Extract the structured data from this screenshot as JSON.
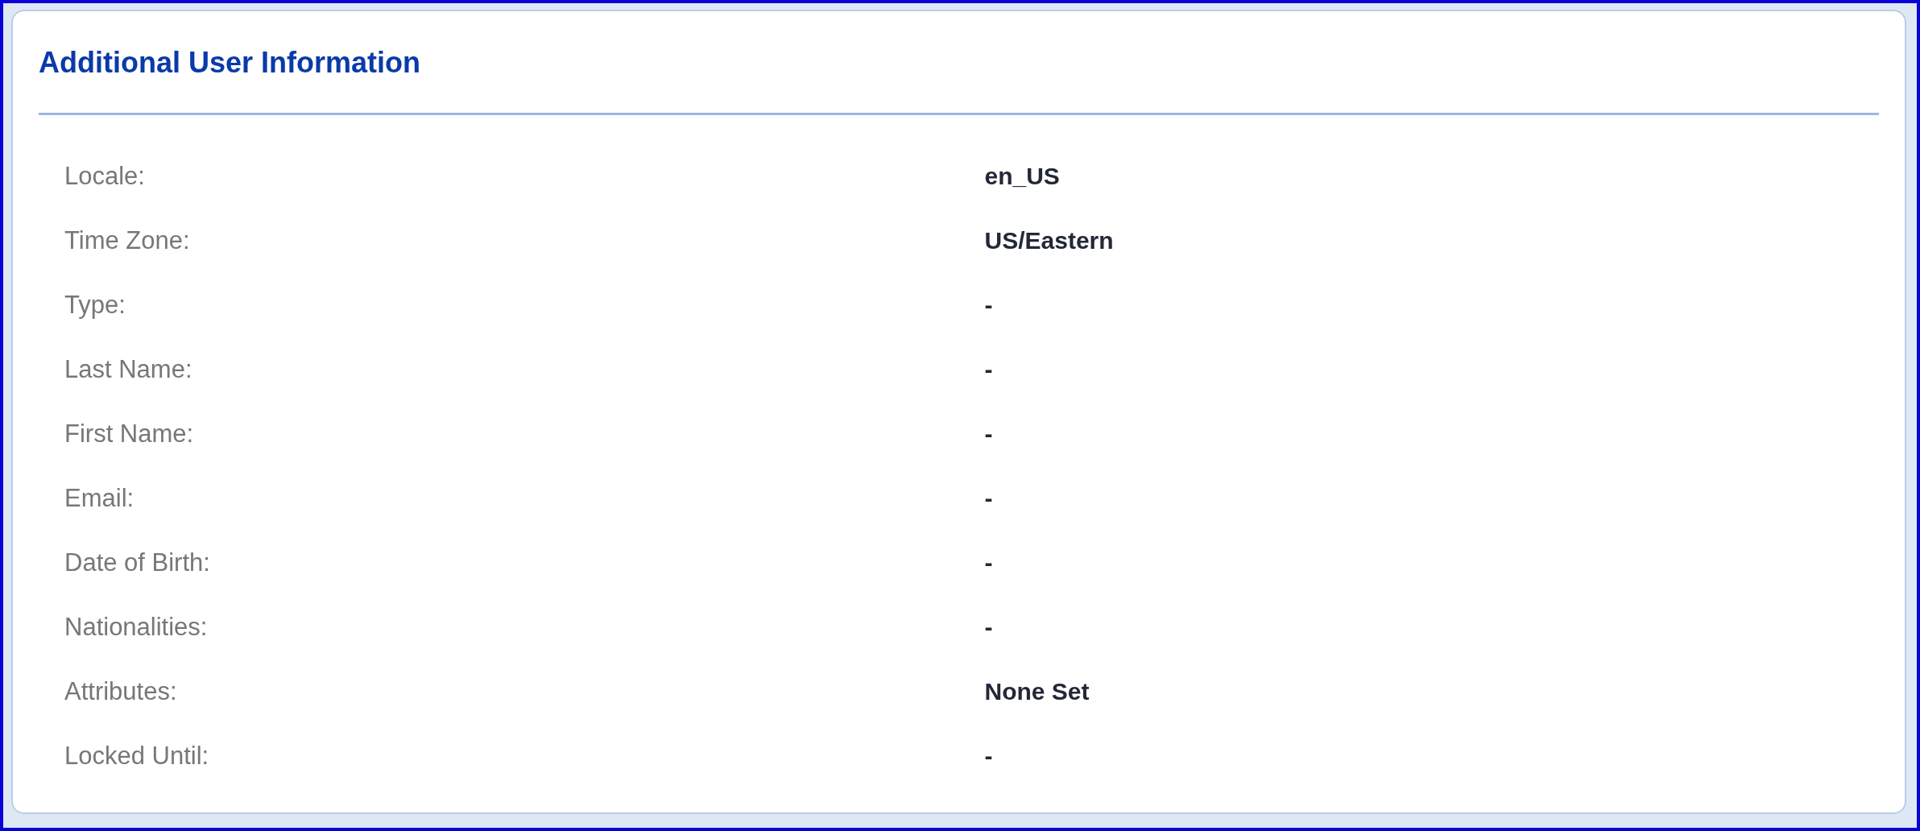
{
  "panel": {
    "title": "Additional User Information",
    "fields": [
      {
        "label": "Locale:",
        "value": "en_US"
      },
      {
        "label": "Time Zone:",
        "value": "US/Eastern"
      },
      {
        "label": "Type:",
        "value": "-"
      },
      {
        "label": "Last Name:",
        "value": "-"
      },
      {
        "label": "First Name:",
        "value": "-"
      },
      {
        "label": "Email:",
        "value": "-"
      },
      {
        "label": "Date of Birth:",
        "value": "-"
      },
      {
        "label": "Nationalities:",
        "value": "-"
      },
      {
        "label": "Attributes:",
        "value": "None Set"
      },
      {
        "label": "Locked Until:",
        "value": "-"
      }
    ]
  }
}
